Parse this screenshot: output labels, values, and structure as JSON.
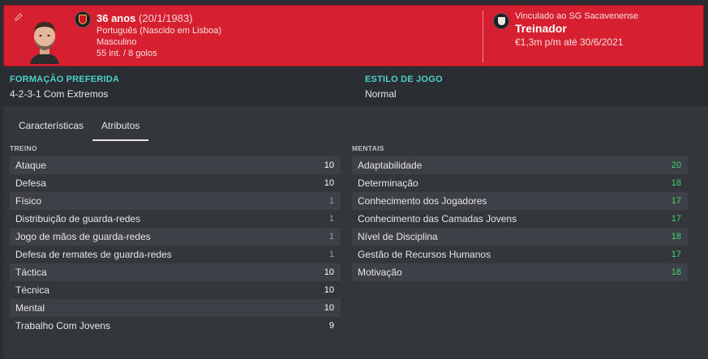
{
  "header": {
    "age": "36 anos",
    "dob": "(20/1/1983)",
    "nationality": "Português (Nascido em Lisboa)",
    "gender": "Masculino",
    "caps": "55 int. / 8 golos",
    "bound_to": "Vinculado ao SG Sacavenense",
    "role": "Treinador",
    "contract": "€1,3m p/m até 30/6/2021"
  },
  "preferences": {
    "formation_label": "FORMAÇÃO PREFERIDA",
    "formation_value": "4-2-3-1 Com Extremos",
    "style_label": "ESTILO DE JOGO",
    "style_value": "Normal"
  },
  "tabs": [
    {
      "label": "Características"
    },
    {
      "label": "Atributos"
    }
  ],
  "training": {
    "label": "TREINO",
    "rows": [
      {
        "name": "Ataque",
        "value": "10",
        "level": "mid"
      },
      {
        "name": "Defesa",
        "value": "10",
        "level": "mid"
      },
      {
        "name": "Físico",
        "value": "1",
        "level": "low"
      },
      {
        "name": "Distribuição de guarda-redes",
        "value": "1",
        "level": "low"
      },
      {
        "name": "Jogo de mãos de guarda-redes",
        "value": "1",
        "level": "low"
      },
      {
        "name": "Defesa de remates de guarda-redes",
        "value": "1",
        "level": "low"
      },
      {
        "name": "Táctica",
        "value": "10",
        "level": "mid"
      },
      {
        "name": "Técnica",
        "value": "10",
        "level": "mid"
      },
      {
        "name": "Mental",
        "value": "10",
        "level": "mid"
      },
      {
        "name": "Trabalho Com Jovens",
        "value": "9",
        "level": "mid"
      }
    ]
  },
  "mental": {
    "label": "MENTAIS",
    "rows": [
      {
        "name": "Adaptabilidade",
        "value": "20",
        "level": "high"
      },
      {
        "name": "Determinação",
        "value": "18",
        "level": "high"
      },
      {
        "name": "Conhecimento dos Jogadores",
        "value": "17",
        "level": "high"
      },
      {
        "name": "Conhecimento das Camadas Jovens",
        "value": "17",
        "level": "high"
      },
      {
        "name": "Nível de Disciplina",
        "value": "18",
        "level": "high"
      },
      {
        "name": "Gestão de Recursos Humanos",
        "value": "17",
        "level": "high"
      },
      {
        "name": "Motivação",
        "value": "18",
        "level": "high"
      }
    ]
  },
  "colors": {
    "header_red": "#d6202f",
    "accent_teal": "#4fd0c9",
    "high_green": "#3fd66b"
  }
}
